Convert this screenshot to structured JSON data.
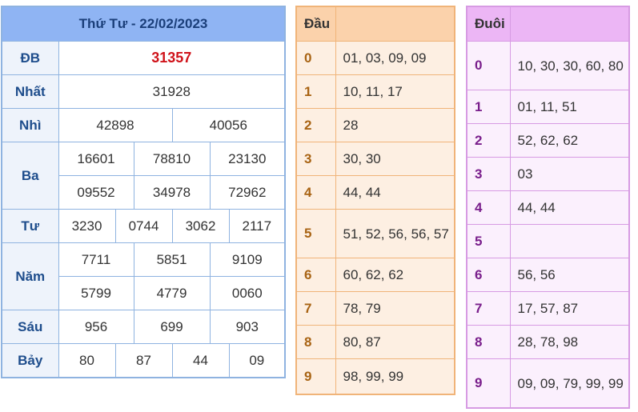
{
  "results": {
    "title": "Thứ Tư - 22/02/2023",
    "prizes": {
      "db": {
        "label": "ĐB",
        "values": [
          "31357"
        ]
      },
      "nhat": {
        "label": "Nhất",
        "values": [
          "31928"
        ]
      },
      "nhi": {
        "label": "Nhì",
        "values": [
          "42898",
          "40056"
        ]
      },
      "ba": {
        "label": "Ba",
        "values": [
          "16601",
          "78810",
          "23130",
          "09552",
          "34978",
          "72962"
        ]
      },
      "tu": {
        "label": "Tư",
        "values": [
          "3230",
          "0744",
          "3062",
          "2117"
        ]
      },
      "nam": {
        "label": "Năm",
        "values": [
          "7711",
          "5851",
          "9109",
          "5799",
          "4779",
          "0060"
        ]
      },
      "sau": {
        "label": "Sáu",
        "values": [
          "956",
          "699",
          "903"
        ]
      },
      "bay": {
        "label": "Bảy",
        "values": [
          "80",
          "87",
          "44",
          "09"
        ]
      }
    }
  },
  "head": {
    "header": "Đầu",
    "rows": [
      {
        "digit": "0",
        "values": "01, 03, 09, 09"
      },
      {
        "digit": "1",
        "values": "10, 11, 17"
      },
      {
        "digit": "2",
        "values": "28"
      },
      {
        "digit": "3",
        "values": "30, 30"
      },
      {
        "digit": "4",
        "values": "44, 44"
      },
      {
        "digit": "5",
        "values": "51, 52, 56, 56, 57"
      },
      {
        "digit": "6",
        "values": "60, 62, 62"
      },
      {
        "digit": "7",
        "values": "78, 79"
      },
      {
        "digit": "8",
        "values": "80, 87"
      },
      {
        "digit": "9",
        "values": "98, 99, 99"
      }
    ]
  },
  "tail": {
    "header": "Đuôi",
    "rows": [
      {
        "digit": "0",
        "values": "10, 30, 30, 60, 80"
      },
      {
        "digit": "1",
        "values": "01, 11, 51"
      },
      {
        "digit": "2",
        "values": "52, 62, 62"
      },
      {
        "digit": "3",
        "values": "03"
      },
      {
        "digit": "4",
        "values": "44, 44"
      },
      {
        "digit": "5",
        "values": ""
      },
      {
        "digit": "6",
        "values": "56, 56"
      },
      {
        "digit": "7",
        "values": "17, 57, 87"
      },
      {
        "digit": "8",
        "values": "28, 78, 98"
      },
      {
        "digit": "9",
        "values": "09, 09, 79, 99, 99"
      }
    ]
  }
}
